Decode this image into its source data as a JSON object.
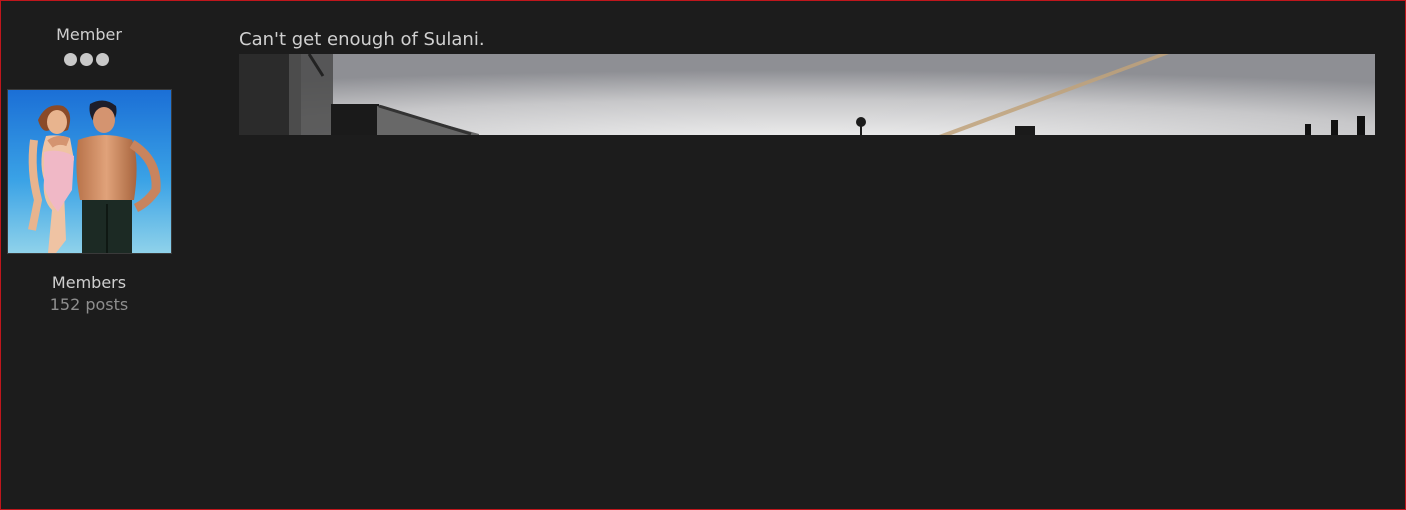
{
  "author": {
    "rank_title": "Member",
    "rank_pips": 3,
    "avatar_alt": "",
    "group": "Members",
    "post_count": "152 posts"
  },
  "post": {
    "body_text": "Can't get enough of Sulani."
  },
  "colors": {
    "background": "#1c1c1c",
    "border": "#c0161c",
    "text": "#cfcfcf",
    "muted": "#8e8e8e"
  }
}
